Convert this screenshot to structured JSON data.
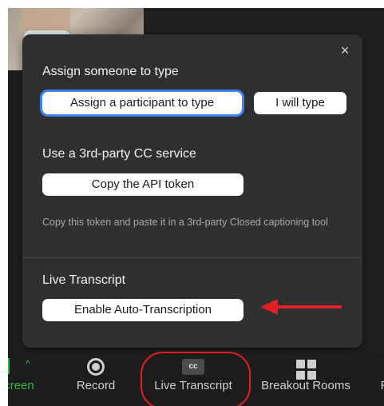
{
  "popup": {
    "close_glyph": "×",
    "assign": {
      "heading": "Assign someone to type",
      "assign_participant_label": "Assign a participant to type",
      "i_will_type_label": "I will type"
    },
    "third_party": {
      "heading": "Use a 3rd-party CC service",
      "copy_token_label": "Copy the API token",
      "helper_text": "Copy this token and paste it in a 3rd-party Closed captioning tool"
    },
    "live_transcript": {
      "heading": "Live Transcript",
      "enable_label": "Enable Auto-Transcription"
    }
  },
  "toolbar": {
    "items": [
      {
        "label": "creen",
        "icon": "share-screen-icon"
      },
      {
        "label": "Record",
        "icon": "record-icon"
      },
      {
        "label": "Live Transcript",
        "icon": "cc-icon",
        "icon_text": "cc"
      },
      {
        "label": "Breakout Rooms",
        "icon": "grid-icon"
      },
      {
        "label": "R",
        "icon": "reactions-icon"
      }
    ]
  },
  "colors": {
    "focus_ring": "#3a82f7",
    "annotation_red": "#e02020",
    "share_green": "#31b44b"
  }
}
